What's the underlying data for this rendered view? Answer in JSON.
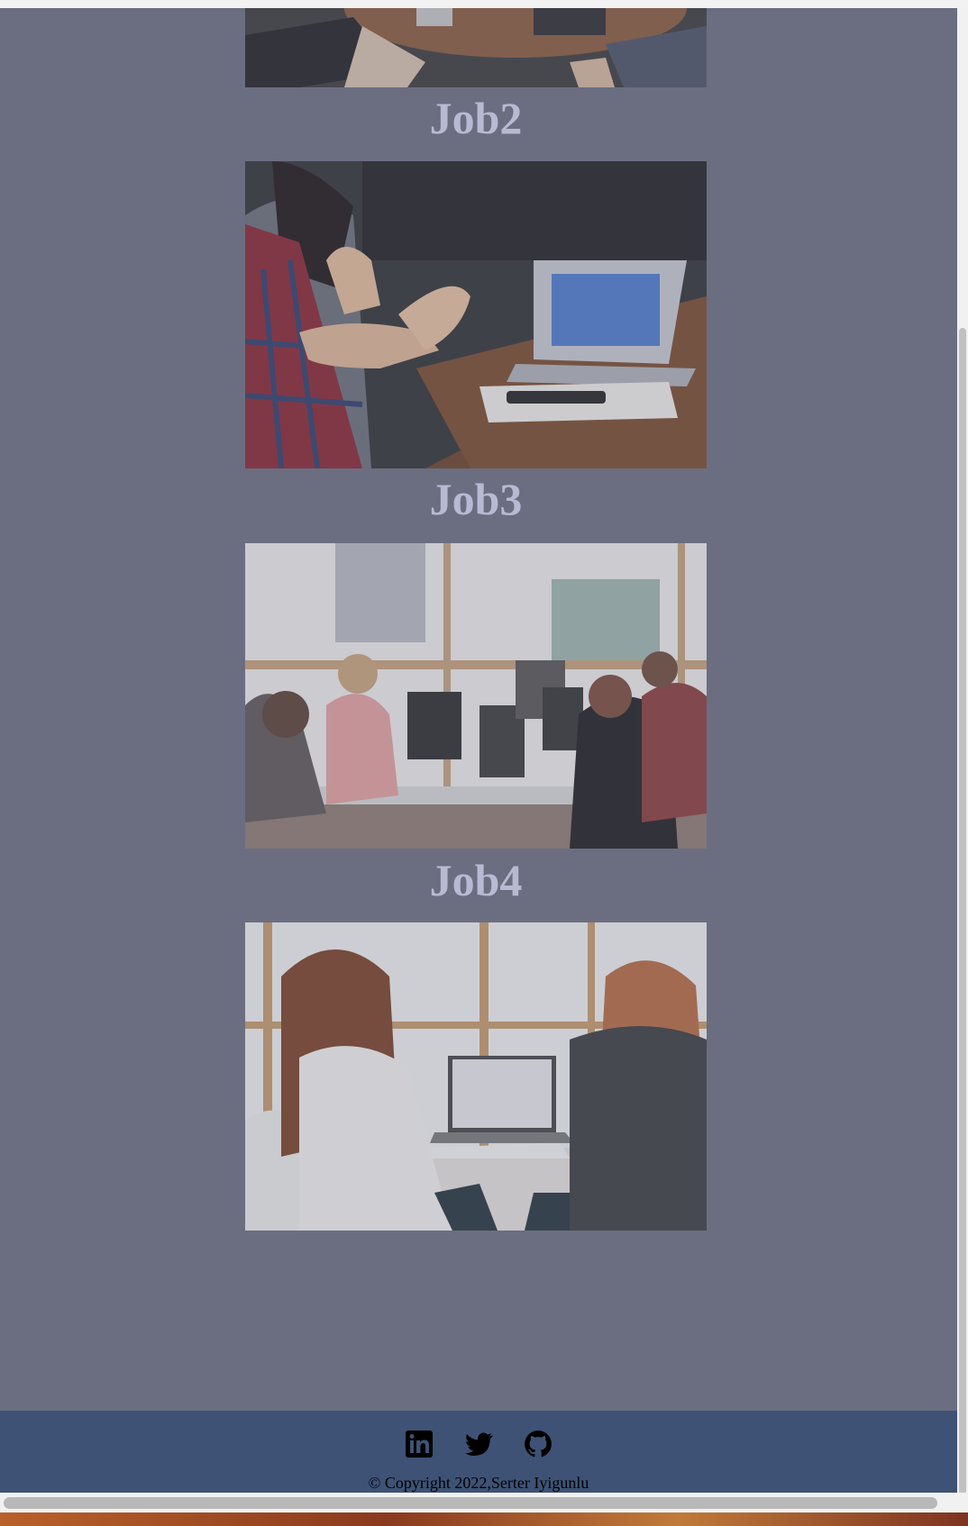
{
  "jobs": [
    {
      "title": "Job2"
    },
    {
      "title": "Job3"
    },
    {
      "title": "Job4"
    }
  ],
  "photos": [
    {
      "name": "meeting-table-photo"
    },
    {
      "name": "laptop-discussion-photo"
    },
    {
      "name": "open-office-photo"
    },
    {
      "name": "two-women-laptop-photo"
    }
  ],
  "footer": {
    "icons": [
      "linkedin-icon",
      "twitter-icon",
      "github-icon"
    ],
    "copyright": "© Copyright 2022,Serter Iyigunlu"
  },
  "colors": {
    "page_bg": "#6b6e80",
    "title_color": "#b8b9d2",
    "footer_bg": "#3e5276"
  }
}
